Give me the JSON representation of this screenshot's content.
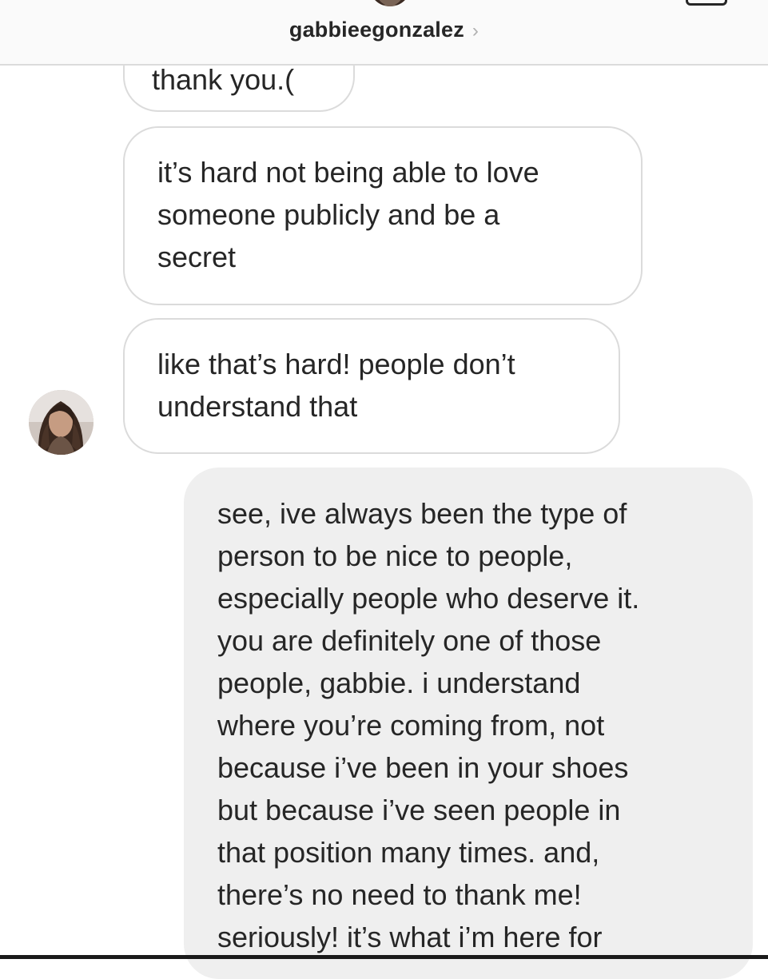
{
  "header": {
    "username": "gabbieegonzalez",
    "chevron": "›"
  },
  "messages": [
    {
      "sender": "them",
      "text": "thank you.("
    },
    {
      "sender": "them",
      "text": "it’s hard not being able to love\nsomeone publicly and be a\nsecret"
    },
    {
      "sender": "them",
      "text": "like that’s hard! people don’t\nunderstand that"
    },
    {
      "sender": "me",
      "text": "see, ive always been the type of\nperson to be nice to people,\nespecially people who deserve it.\nyou are definitely one of those\npeople, gabbie. i understand\nwhere you’re coming from, not\nbecause i’ve been in your shoes\nbut because i’ve seen people in\nthat position many times. and,\nthere’s no need to thank me!\nseriously! it’s what i’m here for"
    }
  ],
  "icons": {
    "header_avatar": "profile-photo-icon",
    "header_right": "video-call-icon",
    "message_avatar": "profile-photo-icon"
  },
  "colors": {
    "header_bg": "#fafafa",
    "incoming_bubble_border": "#dbdbdb",
    "outgoing_bubble_bg": "#efefef",
    "text": "#262626"
  }
}
